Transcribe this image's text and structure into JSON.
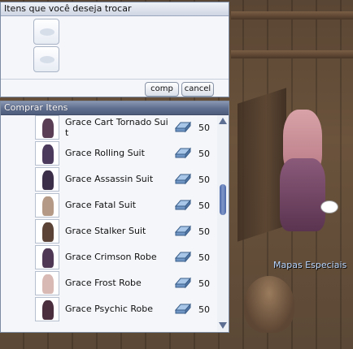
{
  "trade": {
    "title": "Itens que você deseja trocar",
    "slots": [
      {},
      {}
    ],
    "comp_label": "comp",
    "cancel_label": "cancel"
  },
  "buy": {
    "title": "Comprar Itens",
    "items": [
      {
        "name": "Grace Cart Tornado Suit",
        "price": "50",
        "color": "#5a3e55"
      },
      {
        "name": "Grace Rolling Suit",
        "price": "50",
        "color": "#4b3a5c"
      },
      {
        "name": "Grace Assassin Suit",
        "price": "50",
        "color": "#3b2f4a"
      },
      {
        "name": "Grace Fatal Suit",
        "price": "50",
        "color": "#b49a86"
      },
      {
        "name": "Grace Stalker Suit",
        "price": "50",
        "color": "#5b4437"
      },
      {
        "name": "Grace Crimson Robe",
        "price": "50",
        "color": "#4e3855"
      },
      {
        "name": "Grace Frost Robe",
        "price": "50",
        "color": "#d9b9b4"
      },
      {
        "name": "Grace Psychic Robe",
        "price": "50",
        "color": "#4b2f3f"
      }
    ]
  },
  "world": {
    "map_label": "Mapas Especiais"
  },
  "icons": {
    "item": "costume-suit-icon",
    "currency": "blue-bag-icon"
  }
}
